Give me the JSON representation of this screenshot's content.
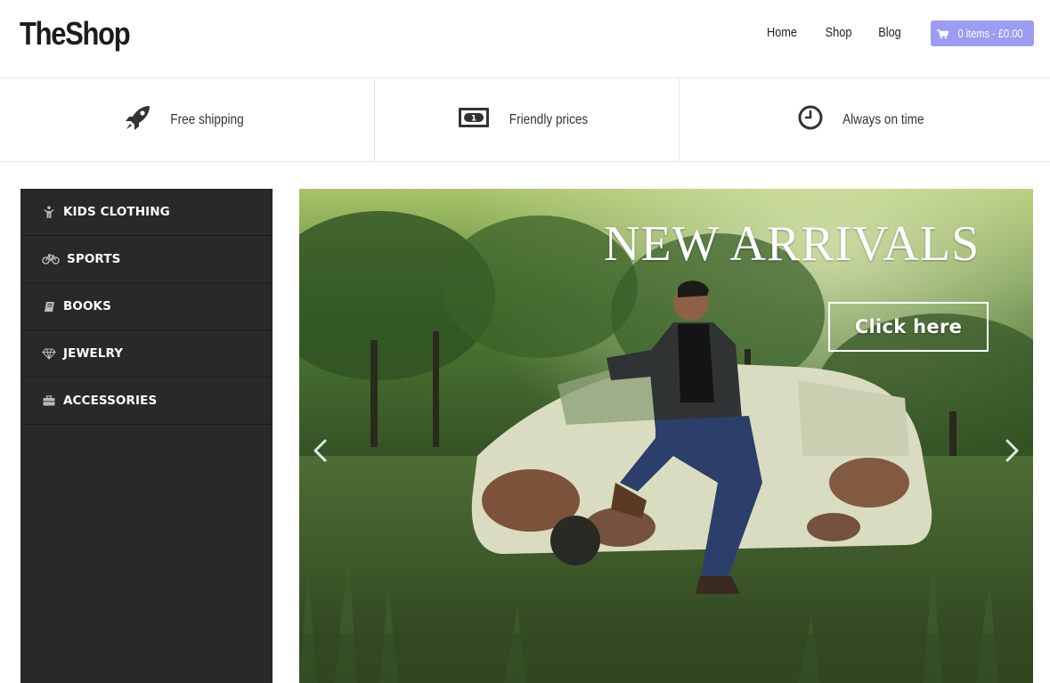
{
  "header": {
    "logo": "TheShop",
    "nav": [
      {
        "label": "Home"
      },
      {
        "label": "Shop"
      },
      {
        "label": "Blog"
      }
    ],
    "cart_label": "0 items - £0.00",
    "cart_color": "#9d9cf3"
  },
  "features": [
    {
      "icon": "rocket-icon",
      "label": "Free shipping"
    },
    {
      "icon": "money-icon",
      "label": "Friendly prices"
    },
    {
      "icon": "clock-icon",
      "label": "Always on time"
    }
  ],
  "sidebar": {
    "items": [
      {
        "icon": "child-icon",
        "label": "KIDS CLOTHING"
      },
      {
        "icon": "bicycle-icon",
        "label": "SPORTS"
      },
      {
        "icon": "book-icon",
        "label": "BOOKS"
      },
      {
        "icon": "diamond-icon",
        "label": "JEWELRY"
      },
      {
        "icon": "briefcase-icon",
        "label": "ACCESSORIES"
      }
    ]
  },
  "hero": {
    "title": "NEW ARRIVALS",
    "cta": "Click here"
  }
}
